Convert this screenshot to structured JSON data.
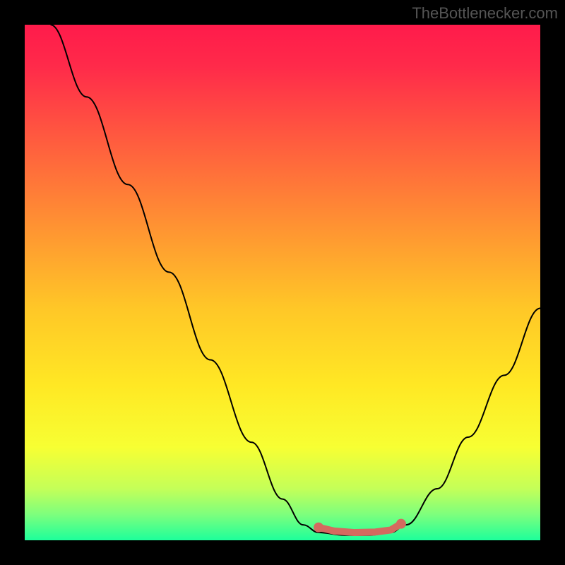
{
  "watermark": "TheBottlenecker.com",
  "chart_data": {
    "type": "line",
    "title": "",
    "xlabel": "",
    "ylabel": "",
    "xlim": [
      0,
      100
    ],
    "ylim": [
      0,
      100
    ],
    "background": {
      "type": "gradient",
      "stops": [
        {
          "offset": 0.0,
          "color": "#ff1b4b"
        },
        {
          "offset": 0.08,
          "color": "#ff2a4a"
        },
        {
          "offset": 0.22,
          "color": "#ff5a3f"
        },
        {
          "offset": 0.38,
          "color": "#ff8f33"
        },
        {
          "offset": 0.55,
          "color": "#ffc727"
        },
        {
          "offset": 0.7,
          "color": "#ffe824"
        },
        {
          "offset": 0.82,
          "color": "#f7ff33"
        },
        {
          "offset": 0.9,
          "color": "#c4ff58"
        },
        {
          "offset": 0.95,
          "color": "#7dff7d"
        },
        {
          "offset": 1.0,
          "color": "#1dff9b"
        }
      ]
    },
    "series": [
      {
        "name": "bottleneck-curve",
        "type": "line",
        "color": "#000000",
        "points": [
          {
            "x": 5,
            "y": 100
          },
          {
            "x": 12,
            "y": 86
          },
          {
            "x": 20,
            "y": 69
          },
          {
            "x": 28,
            "y": 52
          },
          {
            "x": 36,
            "y": 35
          },
          {
            "x": 44,
            "y": 19
          },
          {
            "x": 50,
            "y": 8
          },
          {
            "x": 54,
            "y": 3
          },
          {
            "x": 57,
            "y": 1.5
          },
          {
            "x": 62,
            "y": 1
          },
          {
            "x": 67,
            "y": 1
          },
          {
            "x": 71,
            "y": 1.5
          },
          {
            "x": 74,
            "y": 3
          },
          {
            "x": 80,
            "y": 10
          },
          {
            "x": 86,
            "y": 20
          },
          {
            "x": 93,
            "y": 32
          },
          {
            "x": 100,
            "y": 45
          }
        ]
      },
      {
        "name": "optimal-range",
        "type": "marker-line",
        "color": "#d46a5f",
        "points": [
          {
            "x": 57,
            "y": 2.5
          },
          {
            "x": 60,
            "y": 1.8
          },
          {
            "x": 64,
            "y": 1.5
          },
          {
            "x": 68,
            "y": 1.6
          },
          {
            "x": 71,
            "y": 2.0
          },
          {
            "x": 73,
            "y": 3.2
          }
        ]
      }
    ]
  }
}
